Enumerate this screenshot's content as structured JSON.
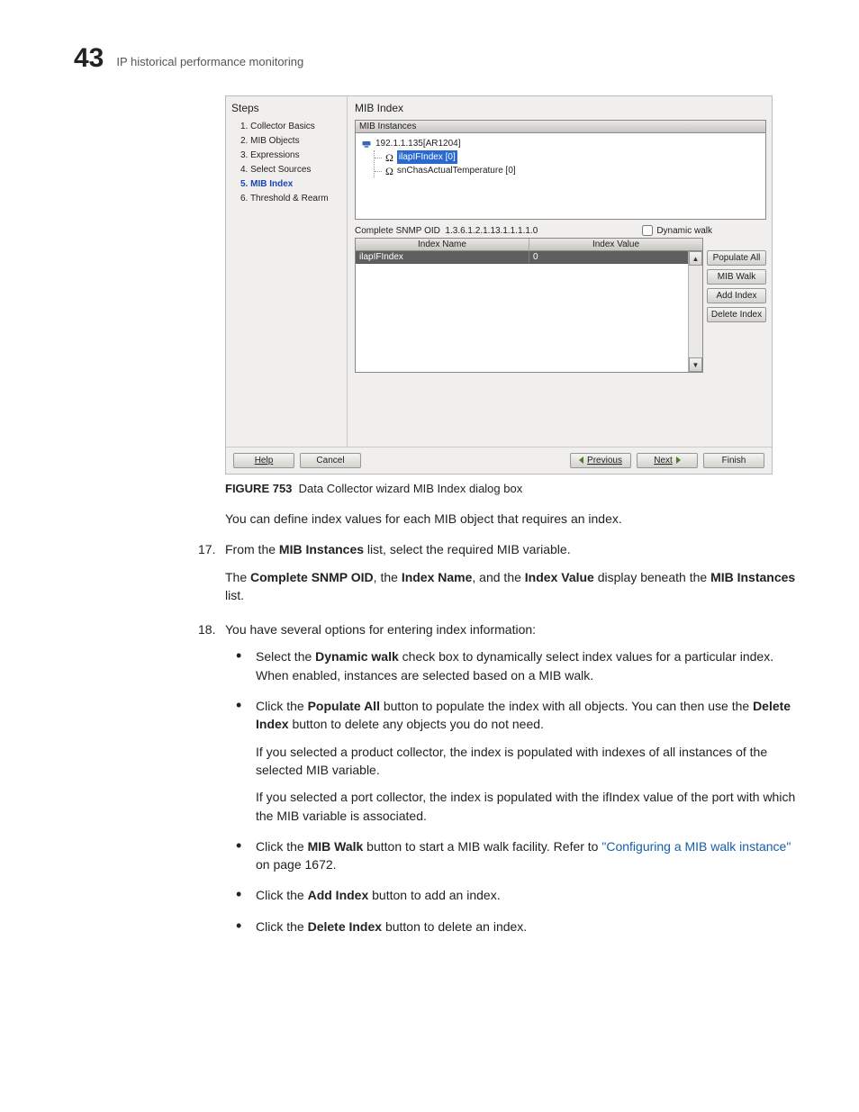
{
  "header": {
    "chapter": "43",
    "title": "IP historical performance monitoring"
  },
  "dialog": {
    "steps_title": "Steps",
    "steps": [
      "1. Collector Basics",
      "2. MIB Objects",
      "3. Expressions",
      "4. Select Sources",
      "5. MIB Index",
      "6. Threshold & Rearm"
    ],
    "current_step_idx": 4,
    "panel_title": "MIB Index",
    "instances_label": "MIB Instances",
    "tree_root": "192.1.1.135[AR1204]",
    "tree_children": [
      {
        "label": "ilapIFIndex [0]",
        "selected": true
      },
      {
        "label": "snChasActualTemperature [0]",
        "selected": false
      }
    ],
    "oid_label": "Complete SNMP OID",
    "oid_value": "1.3.6.1.2.1.13.1.1.1.1.0",
    "dynamic_walk_label": "Dynamic walk",
    "col_index_name": "Index Name",
    "col_index_value": "Index Value",
    "row_name": "ilapIFIndex",
    "row_value": "0",
    "btn_populate": "Populate All",
    "btn_mibwalk": "MIB Walk",
    "btn_add": "Add Index",
    "btn_delete": "Delete Index",
    "footer": {
      "help": "Help",
      "cancel": "Cancel",
      "previous": "Previous",
      "next": "Next",
      "finish": "Finish"
    }
  },
  "caption": {
    "label": "FIGURE 753",
    "text": "Data Collector wizard MIB Index dialog box"
  },
  "text": {
    "intro": "You can define index values for each MIB object that requires an index.",
    "s17a": "From the ",
    "s17b": "MIB Instances",
    "s17c": " list, select the required MIB variable.",
    "s17d1": "The ",
    "s17d2": "Complete SNMP OID",
    "s17d3": ", the ",
    "s17d4": "Index Name",
    "s17d5": ", and the ",
    "s17d6": "Index Value",
    "s17d7": " display beneath the ",
    "s17d8": "MIB Instances",
    "s17d9": " list.",
    "s18": "You have several options for entering index information:",
    "b1a": "Select the ",
    "b1b": "Dynamic walk",
    "b1c": " check box to dynamically select index values for a particular index. When enabled, instances are selected based on a MIB walk.",
    "b2a": "Click the ",
    "b2b": "Populate All",
    "b2c": " button to populate the index with all objects. You can then use the ",
    "b2d": "Delete Index",
    "b2e": " button to delete any objects you do not need.",
    "b2f": "If you selected a product collector, the index is populated with indexes of all instances of the selected MIB variable.",
    "b2g": "If you selected a port collector, the index is populated with the ifIndex value of the port with which the MIB variable is associated.",
    "b3a": "Click the ",
    "b3b": "MIB Walk",
    "b3c": " button to start a MIB walk facility. Refer to ",
    "b3link": "\"Configuring a MIB walk instance\"",
    "b3d": " on page 1672.",
    "b4a": "Click the ",
    "b4b": "Add Index",
    "b4c": " button to add an index.",
    "b5a": "Click the ",
    "b5b": "Delete Index",
    "b5c": " button to delete an index."
  },
  "step_numbers": {
    "s17": "17.",
    "s18": "18."
  }
}
